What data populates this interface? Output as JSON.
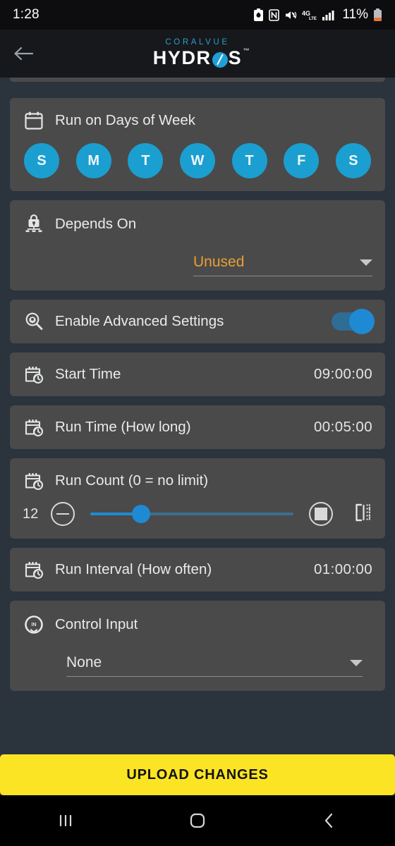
{
  "status_bar": {
    "time": "1:28",
    "battery_percent": "11%",
    "icons": [
      "battery-saver-icon",
      "nfc-icon",
      "vibrate-mute-icon",
      "4g-lte-icon",
      "signal-bars-icon",
      "battery-low-icon"
    ]
  },
  "app_bar": {
    "back_icon": "back-arrow-icon",
    "brand_top": "CORALVUE",
    "brand_main_left": "HYDR",
    "brand_main_right": "S",
    "trademark": "™"
  },
  "cards": {
    "days": {
      "icon": "calendar-icon",
      "label": "Run on Days of Week",
      "days": [
        {
          "letter": "S",
          "name": "sunday",
          "selected": true
        },
        {
          "letter": "M",
          "name": "monday",
          "selected": true
        },
        {
          "letter": "T",
          "name": "tuesday",
          "selected": true
        },
        {
          "letter": "W",
          "name": "wednesday",
          "selected": true
        },
        {
          "letter": "T",
          "name": "thursday",
          "selected": true
        },
        {
          "letter": "F",
          "name": "friday",
          "selected": true
        },
        {
          "letter": "S",
          "name": "saturday",
          "selected": true
        }
      ],
      "selected_color": "#1a9fd0"
    },
    "depends_on": {
      "icon": "lock-network-icon",
      "label": "Depends On",
      "value": "Unused",
      "value_color": "#e8a033"
    },
    "advanced": {
      "icon": "settings-search-icon",
      "label": "Enable Advanced Settings",
      "enabled": true,
      "toggle_color": "#1e8ad4"
    },
    "start_time": {
      "icon": "calendar-clock-icon",
      "label": "Start Time",
      "value": "09:00:00"
    },
    "run_time": {
      "icon": "calendar-clock-icon",
      "label": "Run Time (How long)",
      "value": "00:05:00"
    },
    "run_count": {
      "icon": "calendar-clock-icon",
      "label": "Run Count (0 = no limit)",
      "value": "12",
      "decrement_icon": "minus-circle-icon",
      "increment_icon": "plus-circle-icon",
      "keypad_icon": "numeric-input-icon",
      "slider_percent": 25
    },
    "run_interval": {
      "icon": "calendar-clock-icon",
      "label": "Run Interval (How often)",
      "value": "01:00:00"
    },
    "control_input": {
      "icon": "control-input-icon",
      "label": "Control Input",
      "value": "None"
    }
  },
  "footer": {
    "upload_label": "UPLOAD CHANGES",
    "upload_color": "#fbe424"
  },
  "nav_bar": {
    "recents_icon": "recents-icon",
    "home_icon": "home-icon",
    "back_icon": "back-icon"
  }
}
